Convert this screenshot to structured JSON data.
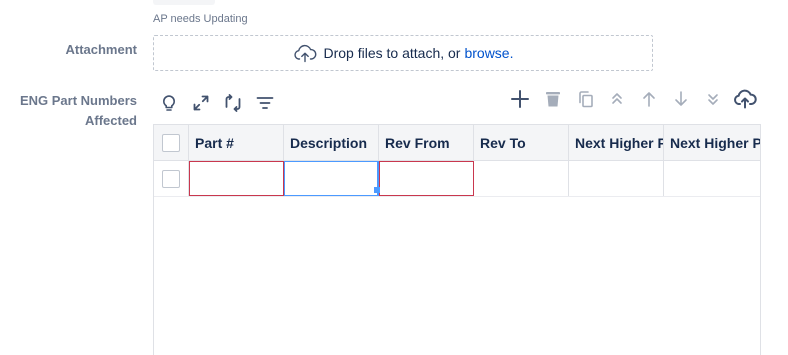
{
  "previous_field": {
    "hint": "AP needs Updating"
  },
  "attachment": {
    "label": "Attachment",
    "drop_text": "Drop files to attach, or",
    "browse_text": "browse."
  },
  "eng_parts": {
    "label": "ENG Part Numbers Affected",
    "columns": [
      "Part #",
      "Description",
      "Rev From",
      "Rev To",
      "Next Higher P",
      "Next Higher P"
    ]
  },
  "icons": {
    "left": [
      "lightbulb-icon",
      "expand-icon",
      "refresh-icon",
      "filter-icon"
    ],
    "right": [
      "add-icon",
      "trash-icon",
      "copy-icon",
      "move-top-icon",
      "move-up-icon",
      "move-down-icon",
      "move-bottom-icon",
      "upload-cloud-icon"
    ]
  },
  "colors": {
    "label": "#6b778c",
    "link": "#0052cc",
    "invalid_border": "#c9374e",
    "active_border": "#4c9aff",
    "header_bg": "#f4f5f7"
  }
}
